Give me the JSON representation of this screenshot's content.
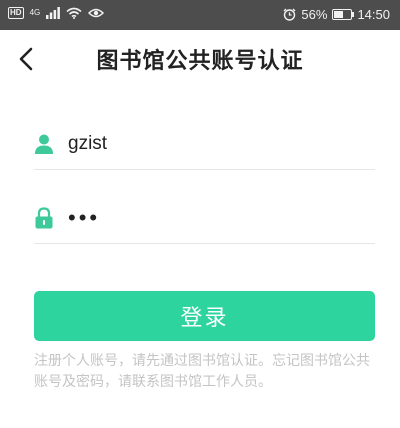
{
  "status_bar": {
    "hd_label": "HD",
    "network_label": "4G",
    "battery_text": "56%",
    "battery_level": 0.56,
    "time": "14:50"
  },
  "nav": {
    "title": "图书馆公共账号认证"
  },
  "form": {
    "username_value": "gzist",
    "password_value": "•••",
    "login_label": "登录"
  },
  "hint": "注册个人账号，请先通过图书馆认证。忘记图书馆公共账号及密码，请联系图书馆工作人员。",
  "colors": {
    "accent": "#2ed49e",
    "field_icon": "#3ec99b",
    "status_bar": "#4d4d4d"
  },
  "icons": {
    "back": "chevron-left-icon",
    "user": "user-icon",
    "password": "lock-icon",
    "wifi": "wifi-icon",
    "signal": "signal-icon",
    "eye": "eye-icon",
    "alarm": "alarm-icon",
    "battery": "battery-icon"
  }
}
